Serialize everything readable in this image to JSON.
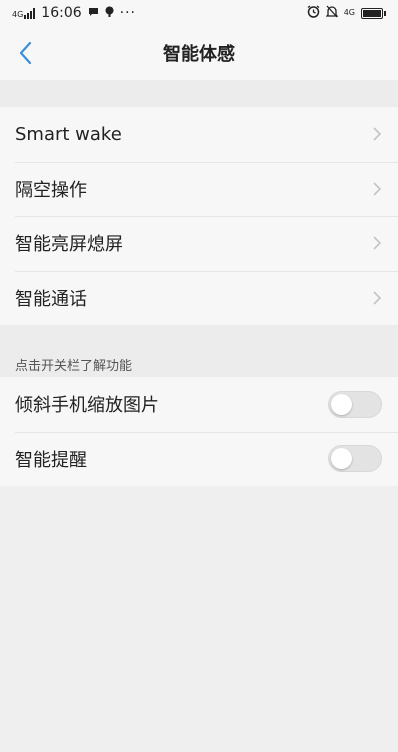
{
  "status_bar": {
    "network": "4G",
    "time": "16:06",
    "more": "···",
    "network_right": "4G"
  },
  "header": {
    "title": "智能体感"
  },
  "menu_items": [
    {
      "label": "Smart wake"
    },
    {
      "label": "隔空操作"
    },
    {
      "label": "智能亮屏熄屏"
    },
    {
      "label": "智能通话"
    }
  ],
  "section": {
    "header": "点击开关栏了解功能"
  },
  "toggles": [
    {
      "label": "倾斜手机缩放图片",
      "on": false
    },
    {
      "label": "智能提醒",
      "on": false
    }
  ],
  "colors": {
    "accent": "#3a8fd9",
    "background": "#efefef",
    "row_background": "#f7f7f7"
  },
  "icons": {
    "back": "chevron-left-icon",
    "row_arrow": "chevron-right-icon"
  }
}
